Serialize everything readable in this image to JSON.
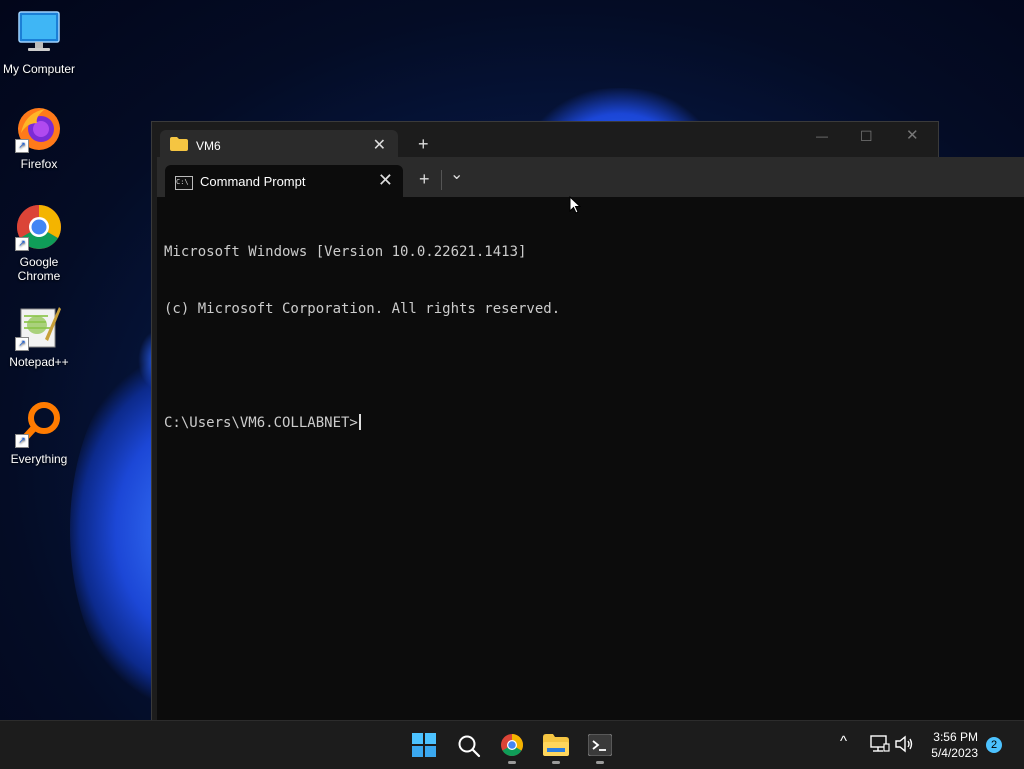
{
  "desktop": {
    "icons": [
      {
        "label": "My Computer"
      },
      {
        "label": "Firefox"
      },
      {
        "label": "Google Chrome"
      },
      {
        "label": "Notepad++"
      },
      {
        "label": "Everything"
      }
    ]
  },
  "back_window": {
    "tab_label": "VM6",
    "new_tab_symbol": "+",
    "close_symbol": "✕",
    "minimize_symbol": "—",
    "maximize_symbol": "☐"
  },
  "terminal": {
    "tab_label": "Command Prompt",
    "tab_close_symbol": "✕",
    "new_tab_symbol": "+",
    "dropdown_symbol": "⌄",
    "lines": [
      "Microsoft Windows [Version 10.0.22621.1413]",
      "(c) Microsoft Corporation. All rights reserved.",
      "",
      "C:\\Users\\VM6.COLLABNET>"
    ]
  },
  "taskbar": {
    "time": "3:56 PM",
    "date": "5/4/2023",
    "notification_count": "2",
    "tray_chevron": "^"
  },
  "colors": {
    "accent": "#4cc2ff",
    "terminal_bg": "#0c0c0c",
    "terminal_text": "#cccccc",
    "tabbar_bg": "#2b2b2b"
  }
}
